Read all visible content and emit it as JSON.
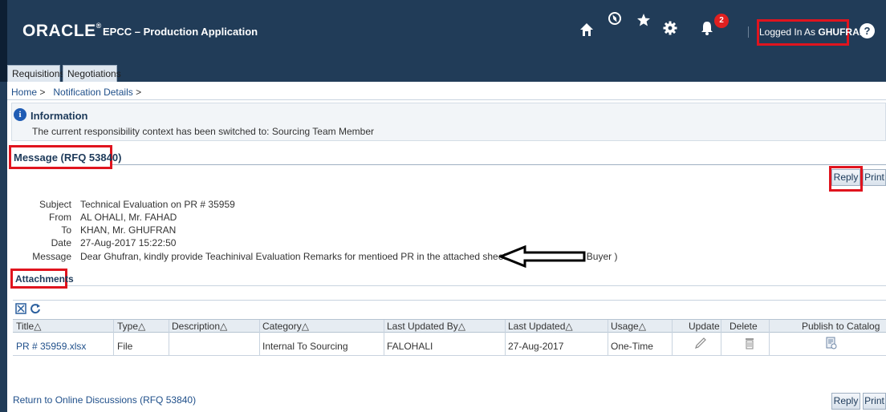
{
  "header": {
    "logo": "ORACLE",
    "logo_reg": "®",
    "app_title": "EPCC – Production Application",
    "notification_count": "2",
    "logged_in_prefix": "Logged In As ",
    "logged_in_user": "GHUFRAN",
    "help_glyph": "?"
  },
  "tabs": [
    "Requisitions",
    "Negotiations"
  ],
  "breadcrumb": {
    "home": "Home",
    "separator": ">",
    "current": "Notification Details"
  },
  "info": {
    "title": "Information",
    "text": "The current responsibility context has been switched to: Sourcing Team Member"
  },
  "message_section": {
    "title": "Message (RFQ 53840)",
    "reply_label": "Reply",
    "print_label": "Print"
  },
  "message": {
    "labels": {
      "subject": "Subject",
      "from": "From",
      "to": "To",
      "date": "Date",
      "message": "Message"
    },
    "subject": "Technical Evaluation on PR # 35959",
    "from": "AL OHALI, Mr. FAHAD",
    "to": "KHAN, Mr. GHUFRAN",
    "date": "27-Aug-2017 15:22:50",
    "body": "Dear Ghufran, kindly provide Teachinival Evaluation Remarks for mentioed PR in the attached sheet Regards, Fahad ( Buyer )"
  },
  "attachments": {
    "title": "Attachments",
    "columns": {
      "title": "Title",
      "type": "Type",
      "description": "Description",
      "category": "Category",
      "last_updated_by": "Last Updated By",
      "last_updated": "Last Updated",
      "usage": "Usage",
      "update": "Update",
      "delete": "Delete",
      "publish": "Publish to Catalog"
    },
    "sort_glyph": "△",
    "rows": [
      {
        "title": "PR # 35959.xlsx",
        "type": "File",
        "description": "",
        "category": "Internal To Sourcing",
        "last_updated_by": "FALOHALI",
        "last_updated": "27-Aug-2017",
        "usage": "One-Time"
      }
    ]
  },
  "footer": {
    "return_link": "Return to Online Discussions (RFQ 53840)",
    "reply_label": "Reply",
    "print_label": "Print"
  },
  "colors": {
    "header_bg": "#213c58",
    "highlight_red": "#e0141e",
    "link_blue": "#1f4f8a",
    "title_navy": "#1d3a5a"
  },
  "icons": [
    "home-icon",
    "compass-icon",
    "star-icon",
    "gear-icon",
    "bell-icon",
    "help-icon",
    "info-icon",
    "detach-icon",
    "refresh-icon",
    "pencil-icon",
    "trash-icon",
    "publish-icon",
    "arrow-icon"
  ]
}
